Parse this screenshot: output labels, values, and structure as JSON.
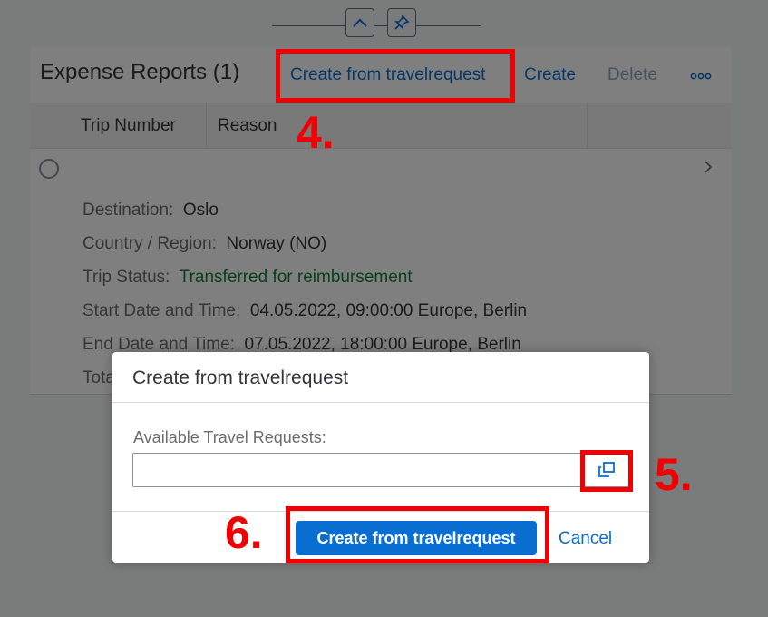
{
  "object_header": {
    "collapse_icon": "chevron-up-icon",
    "pin_icon": "pin-icon"
  },
  "table": {
    "title": "Expense Reports (1)",
    "toolbar": {
      "create_from_travelrequest": "Create from travelrequest",
      "create": "Create",
      "delete": "Delete",
      "overflow_icon": "ellipsis-icon"
    },
    "columns": [
      "Trip Number",
      "Reason"
    ],
    "row": {
      "fields": [
        {
          "label": "Destination:",
          "value": "Oslo"
        },
        {
          "label": "Country / Region:",
          "value": "Norway (NO)"
        },
        {
          "label": "Trip Status:",
          "value": "Transferred for reimbursement",
          "status": "success"
        },
        {
          "label": "Start Date and Time:",
          "value": "04.05.2022, 09:00:00 Europe, Berlin"
        },
        {
          "label": "End Date and Time:",
          "value": "07.05.2022, 18:00:00 Europe, Berlin"
        },
        {
          "label": "Tota",
          "value": ""
        }
      ]
    }
  },
  "dialog": {
    "title": "Create from travelrequest",
    "field_label": "Available Travel Requests:",
    "field_value": "",
    "value_help_icon": "value-help-icon",
    "primary_button": "Create from travelrequest",
    "cancel_button": "Cancel"
  },
  "annotations": {
    "color": "#f00000",
    "steps": [
      "4.",
      "5.",
      "6."
    ]
  },
  "colors": {
    "accent": "#0a6ed1",
    "success_text": "#107e3e"
  }
}
